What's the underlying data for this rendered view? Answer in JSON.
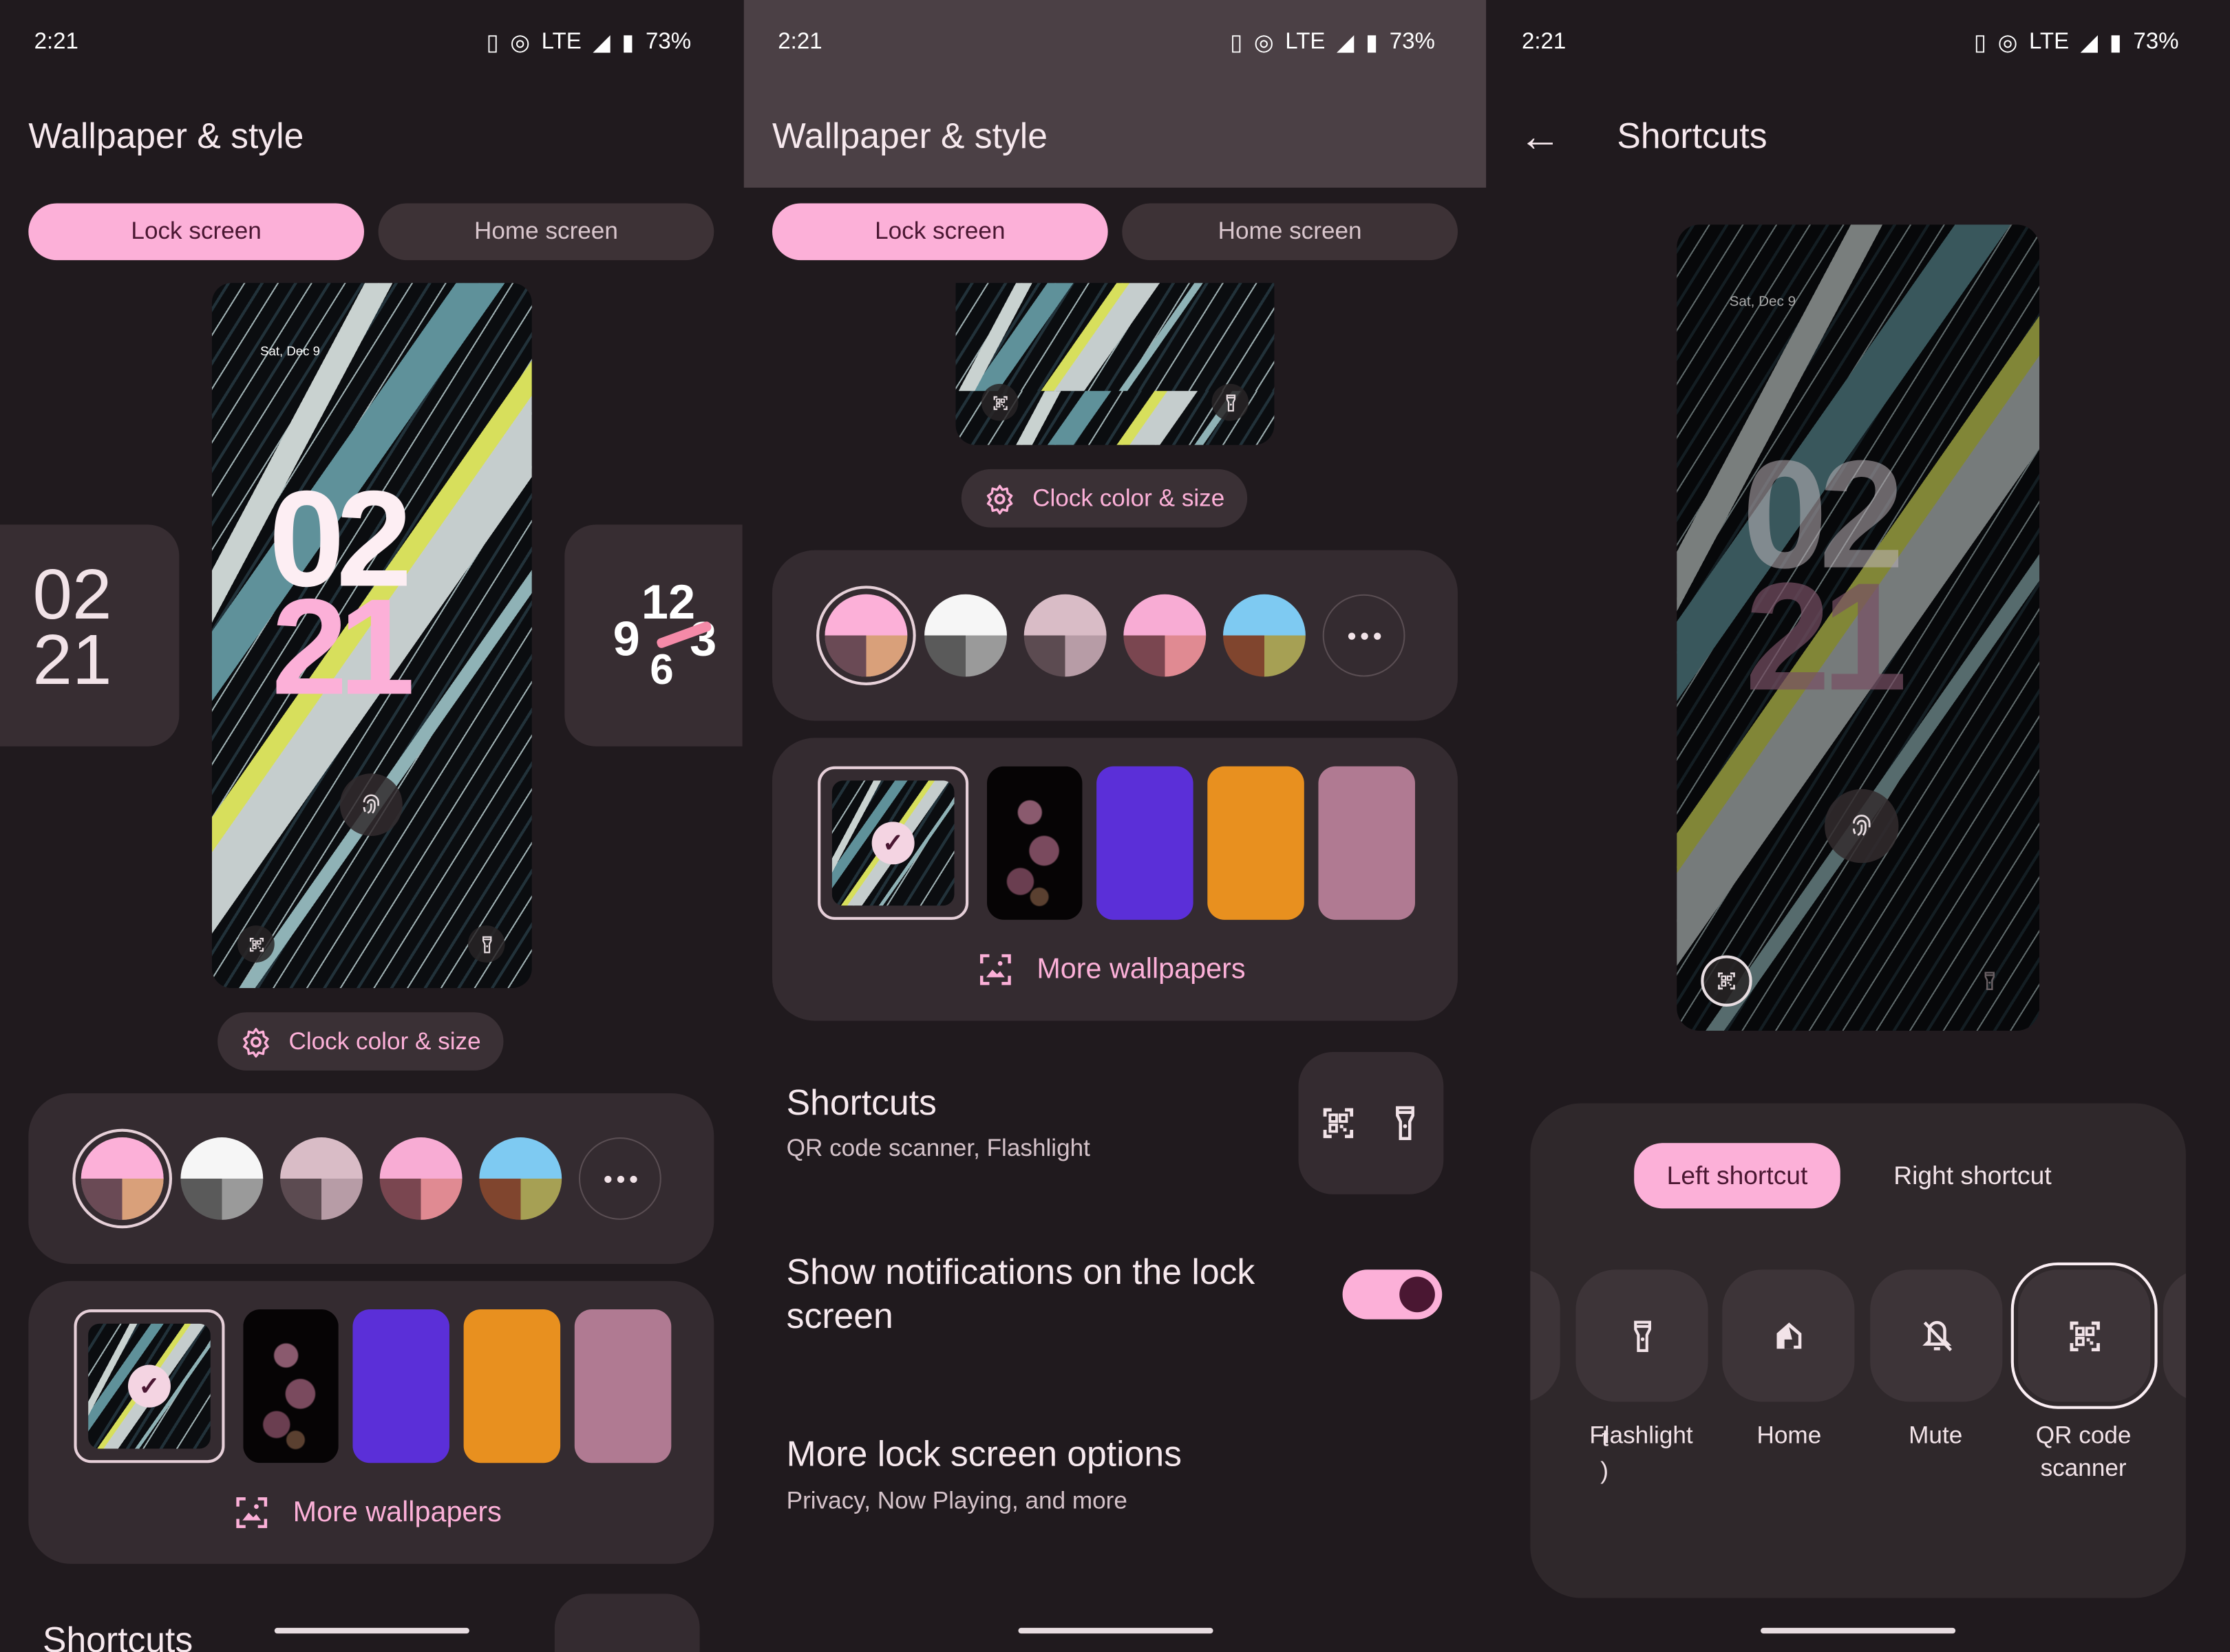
{
  "status": {
    "time": "2:21",
    "network": "LTE",
    "battery": "73%"
  },
  "panel1": {
    "title": "Wallpaper & style",
    "tabs": [
      "Lock screen",
      "Home screen"
    ],
    "preview_date": "Sat, Dec 9",
    "clock_top": "02",
    "clock_bottom": "21",
    "side_clock_left": [
      "02",
      "21"
    ],
    "side_clock_right": [
      "12",
      "9",
      "3",
      "6"
    ],
    "clock_button": "Clock color & size",
    "more_wallpapers": "More wallpapers",
    "shortcuts_title": "Shortcuts"
  },
  "panel2": {
    "title": "Wallpaper & style",
    "tabs": [
      "Lock screen",
      "Home screen"
    ],
    "clock_button": "Clock color & size",
    "more_wallpapers": "More wallpapers",
    "shortcuts": {
      "title": "Shortcuts",
      "subtitle": "QR code scanner, Flashlight"
    },
    "notifications": {
      "title": "Show notifications on the lock screen",
      "enabled": true
    },
    "more_options": {
      "title": "More lock screen options",
      "subtitle": "Privacy, Now Playing, and more"
    }
  },
  "panel3": {
    "title": "Shortcuts",
    "preview_date": "Sat, Dec 9",
    "clock_top": "02",
    "clock_bottom": "21",
    "tabs": [
      "Left shortcut",
      "Right shortcut"
    ],
    "options": [
      {
        "label": "Flashlight",
        "icon": "flashlight-icon"
      },
      {
        "label": "Home",
        "icon": "home-icon"
      },
      {
        "label": "Mute",
        "icon": "mute-icon"
      },
      {
        "label": "QR code scanner",
        "label_lines": [
          "QR code",
          "scanner"
        ],
        "icon": "qr-code-icon",
        "selected": true
      }
    ],
    "partial_left_label": [
      "t",
      ")"
    ]
  },
  "color_options": [
    {
      "top": "#fcb0d8",
      "bl": "#6a4a55",
      "br": "#d9a07a",
      "selected": true
    },
    {
      "top": "#f6f6f6",
      "bl": "#5a5a5a",
      "br": "#9a9a9a"
    },
    {
      "top": "#d9bcc6",
      "bl": "#5c4b51",
      "br": "#b79ca6"
    },
    {
      "top": "#f8acd4",
      "bl": "#7a4650",
      "br": "#e08a92"
    },
    {
      "top": "#7ecaf2",
      "bl": "#80452e",
      "br": "#a6a054"
    }
  ],
  "wallpaper_options": [
    {
      "type": "marble",
      "selected": true
    },
    {
      "type": "flowers"
    },
    {
      "type": "solid",
      "color": "#5b2fd8"
    },
    {
      "type": "solid",
      "color": "#e8901f"
    },
    {
      "type": "solid",
      "color": "#b07a92"
    }
  ],
  "colors": {
    "accent": "#fcb0d8",
    "background": "#201a1e",
    "surface": "#342b30"
  }
}
